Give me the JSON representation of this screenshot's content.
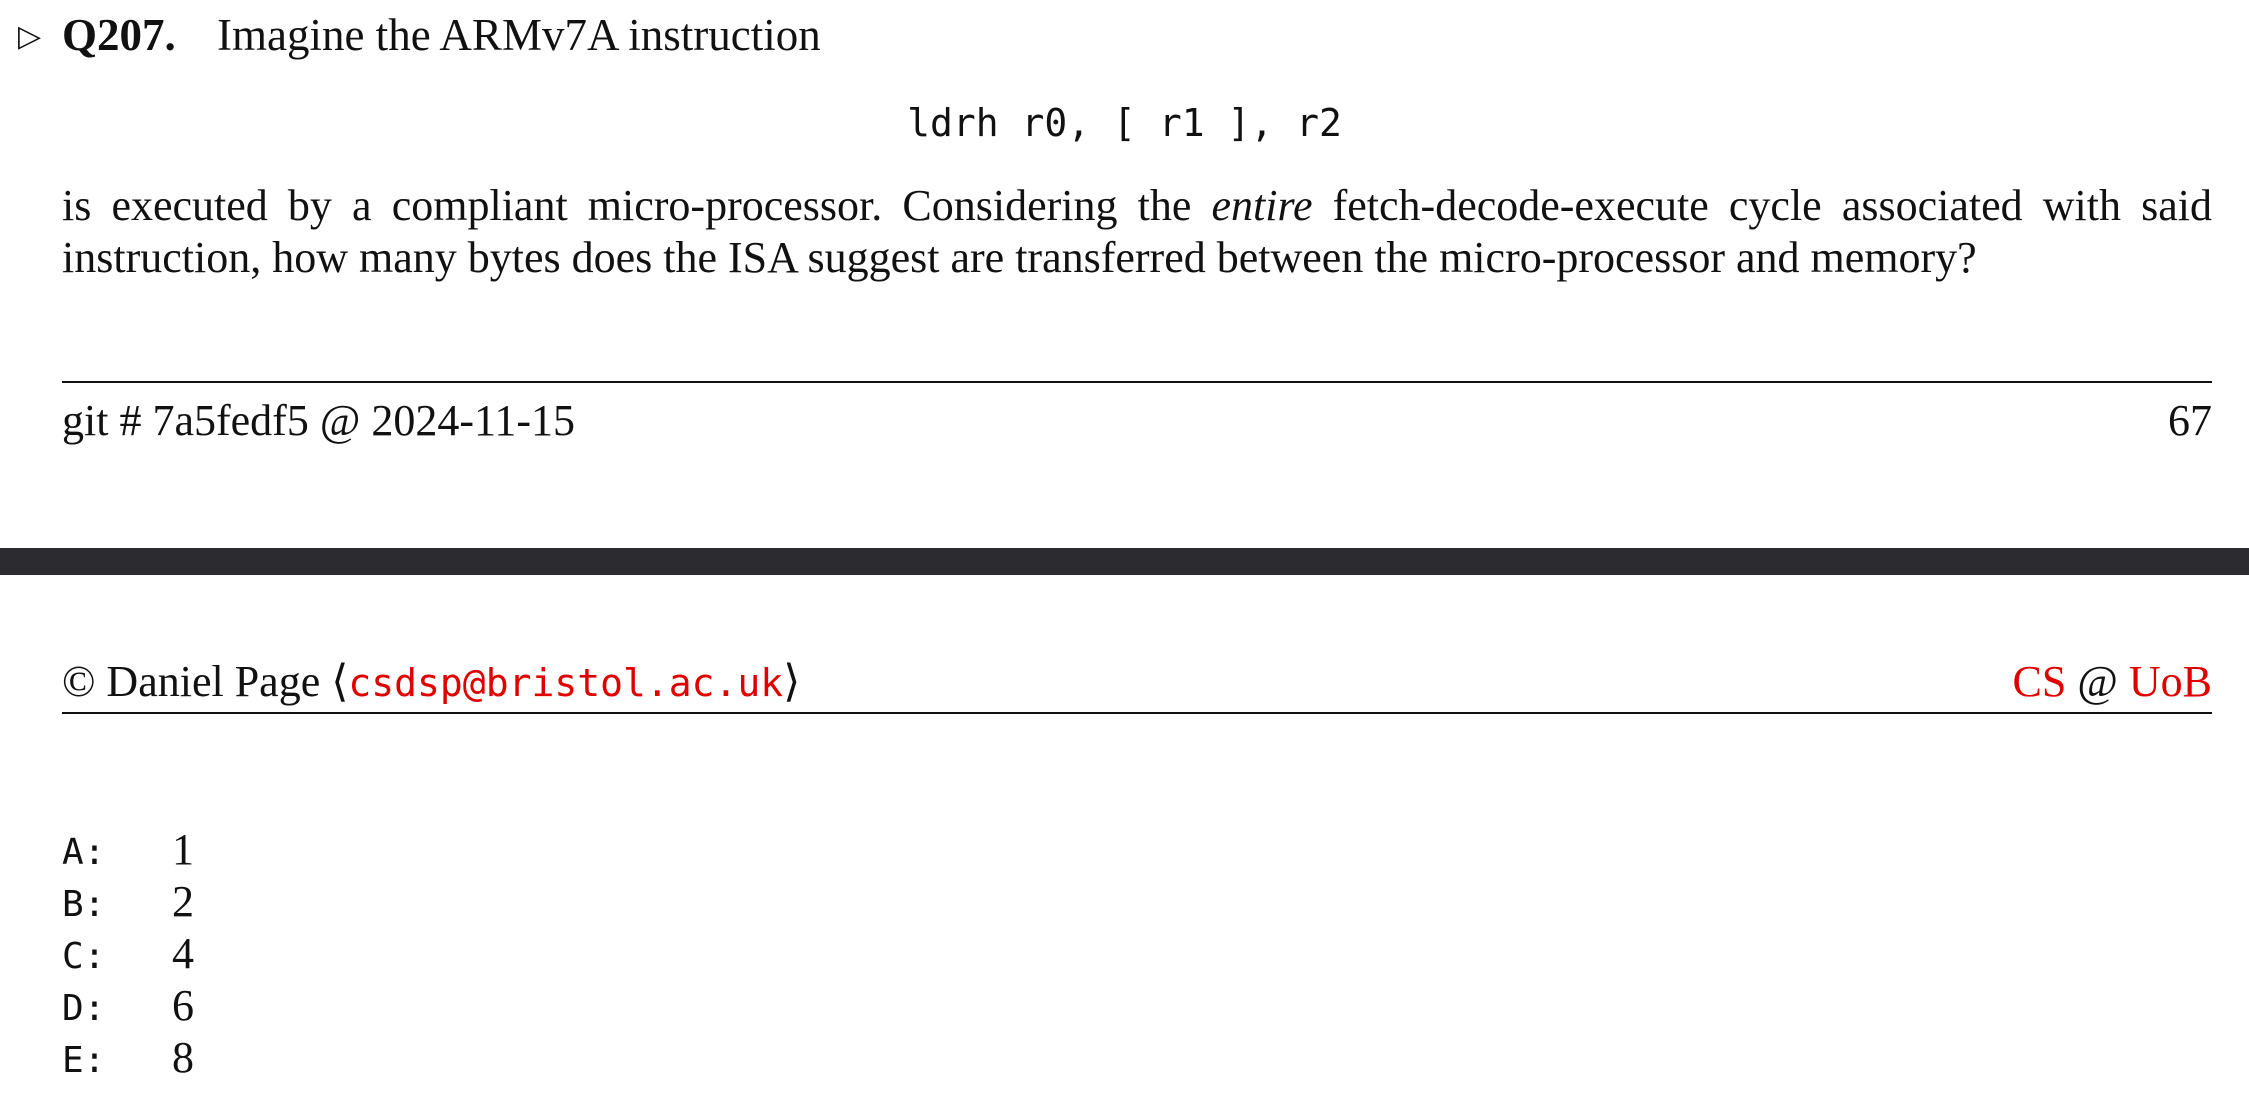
{
  "question": {
    "marker": "▷",
    "number": "Q207.",
    "intro": "Imagine the ARMv7A instruction",
    "code": "ldrh r0, [ r1 ], r2",
    "body_line1_pre": "is executed by a compliant micro-processor.  Considering the ",
    "body_line1_em": "entire",
    "body_line1_post": " fetch-decode-execute cycle associated with said",
    "body_line2": "instruction, how many bytes does the ISA suggest are transferred between the micro-processor and memory?"
  },
  "footer": {
    "git": "git # 7a5fedf5 @ 2024-11-15",
    "page": "67"
  },
  "header": {
    "copyright": "©  Daniel Page ⟨",
    "email": "csdsp@bristol.ac.uk",
    "close": "⟩",
    "cs": "CS",
    "at": " @ ",
    "uob": "UoB"
  },
  "options": [
    {
      "letter": "A:",
      "value": "1"
    },
    {
      "letter": "B:",
      "value": "2"
    },
    {
      "letter": "C:",
      "value": "4"
    },
    {
      "letter": "D:",
      "value": "6"
    },
    {
      "letter": "E:",
      "value": "8"
    }
  ],
  "colors": {
    "accent_red": "#e00000",
    "band": "#2b2b30"
  }
}
